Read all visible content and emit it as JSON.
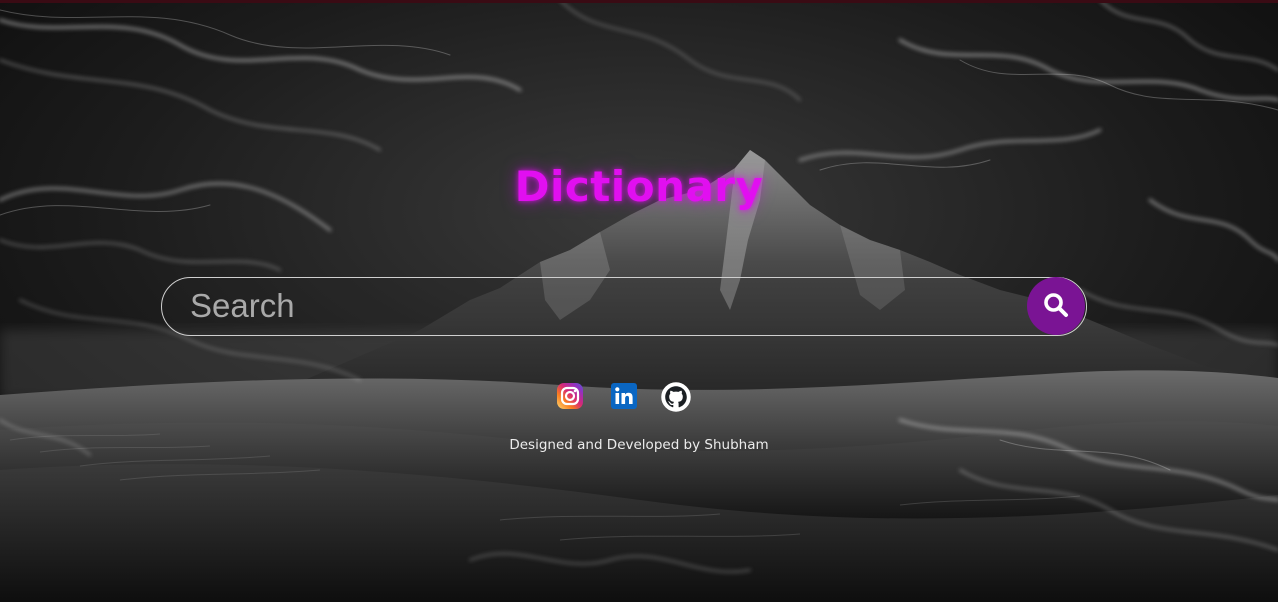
{
  "app": {
    "title": "Dictionary"
  },
  "search": {
    "placeholder": "Search",
    "value": "",
    "button_icon": "magnifier-icon"
  },
  "socials": [
    {
      "name": "instagram",
      "icon": "instagram-icon"
    },
    {
      "name": "linkedin",
      "icon": "linkedin-icon"
    },
    {
      "name": "github",
      "icon": "github-icon"
    }
  ],
  "footer": {
    "credit": "Designed and Developed by Shubham"
  },
  "colors": {
    "title": "#e10ff0",
    "search_button": "#7a1494",
    "search_border": "#cfcfcf",
    "credit_text": "#ececec",
    "background": "#0d0d0d"
  }
}
